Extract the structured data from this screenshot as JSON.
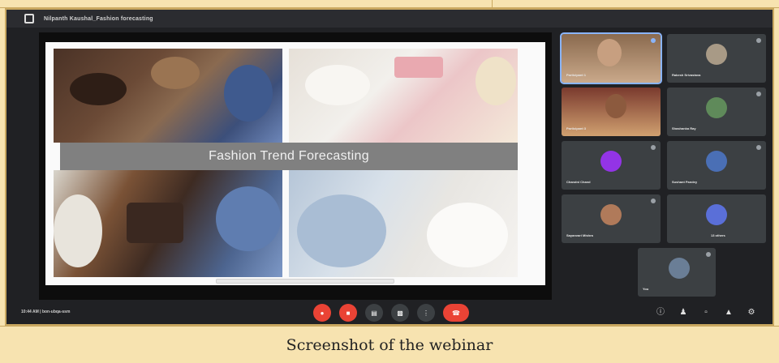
{
  "window": {
    "title": "Nilpanth Kaushal_Fashion forecasting"
  },
  "slide": {
    "banner_text": "Fashion Trend Forecasting"
  },
  "participants": [
    {
      "name": "Participant 1"
    },
    {
      "name": "Rakesh Srivastava"
    },
    {
      "name": "Participant 3"
    },
    {
      "name": "Shashanka Ray"
    },
    {
      "name": "Chandni Chand"
    },
    {
      "name": "Sushant Pandey"
    },
    {
      "name": "Sayanvari Mishra"
    },
    {
      "name": "13 others"
    },
    {
      "name": "You"
    }
  ],
  "bottom": {
    "time_meeting": "10:44 AM | bon-ubqa-ssm"
  },
  "icons": {
    "mic": "mic-off-icon",
    "camera": "camera-off-icon",
    "captions": "captions-icon",
    "present": "present-icon",
    "more": "more-options-icon",
    "end": "end-call-icon",
    "info": "info-icon",
    "people": "people-icon",
    "chat": "chat-icon",
    "activities": "activities-icon",
    "host": "host-controls-icon"
  },
  "colors": {
    "background": "#202124",
    "accent_red": "#ea4335",
    "caption_bg": "#f7e3b0"
  },
  "caption": "Screenshot of the webinar"
}
